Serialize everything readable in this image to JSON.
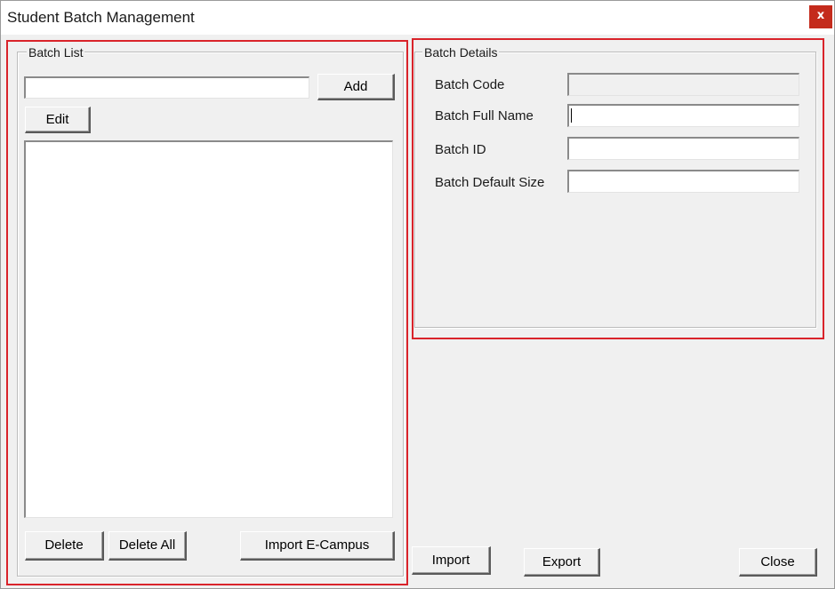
{
  "window": {
    "title": "Student Batch Management",
    "close_glyph": "x"
  },
  "batch_list": {
    "group_title": "Batch List",
    "search_value": "",
    "add_label": "Add",
    "edit_label": "Edit",
    "items": [],
    "delete_label": "Delete",
    "delete_all_label": "Delete All",
    "import_ecampus_label": "Import E-Campus"
  },
  "batch_details": {
    "group_title": "Batch Details",
    "fields": [
      {
        "label": "Batch Code",
        "value": "",
        "enabled": false
      },
      {
        "label": "Batch Full Name",
        "value": "",
        "enabled": true,
        "focused": true
      },
      {
        "label": "Batch ID",
        "value": "",
        "enabled": true
      },
      {
        "label": "Batch Default Size",
        "value": "",
        "enabled": true
      }
    ]
  },
  "footer": {
    "import_label": "Import",
    "export_label": "Export",
    "close_label": "Close"
  },
  "colors": {
    "highlight": "#d9232a",
    "close_button": "#c42b1c",
    "window_bg": "#f0f0f0"
  }
}
